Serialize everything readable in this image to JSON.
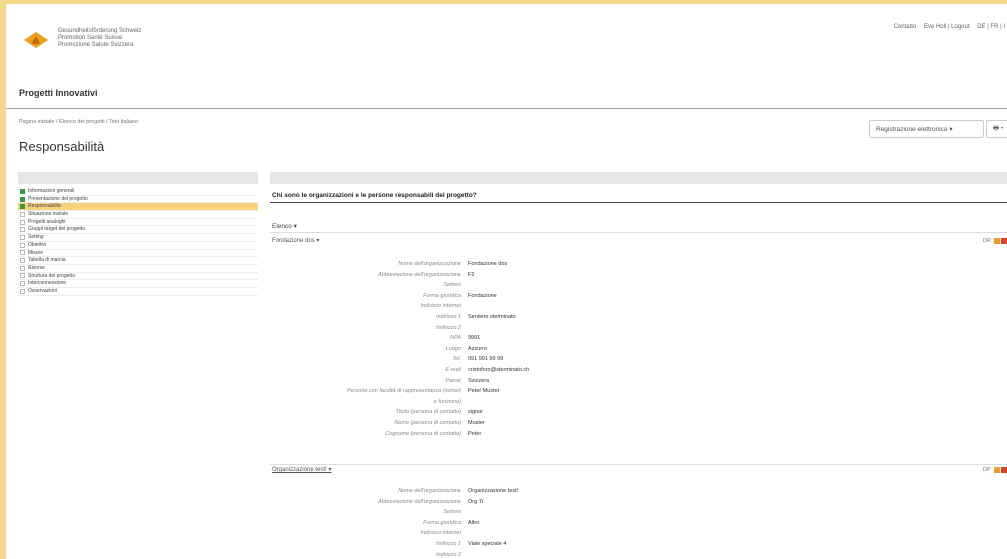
{
  "header": {
    "logo_lines": [
      "Gesundheitsförderung Schweiz",
      "Promotion Santé Suisse",
      "Promozione Salute Svizzera"
    ],
    "links": [
      "Contatto",
      "Eve Holl | Logout",
      "DE | FR | I"
    ]
  },
  "app": {
    "title": "Progetti Innovativi"
  },
  "breadcrumb": "Pagina iniziale / Elenco dei progetti / Test italiano",
  "page_title": "Responsabilità",
  "toolbar": {
    "registration": "Registrazione elettronica ▾",
    "print": "🖶 ▾"
  },
  "sidebar": {
    "items": [
      {
        "label": "Informazioni generali",
        "done": true
      },
      {
        "label": "Presentazione del progetto",
        "done": true
      },
      {
        "label": "Responsabilità",
        "done": true,
        "active": true
      },
      {
        "label": "Situazione iniziale",
        "done": false
      },
      {
        "label": "Progetti analoghi",
        "done": false
      },
      {
        "label": "Gruppi target del progetto",
        "done": false
      },
      {
        "label": "Setting",
        "done": false
      },
      {
        "label": "Obiettivi",
        "done": false
      },
      {
        "label": "Misure",
        "done": false
      },
      {
        "label": "Tabella di marcia",
        "done": false
      },
      {
        "label": "Risorse",
        "done": false
      },
      {
        "label": "Struttura del progetto",
        "done": false
      },
      {
        "label": "Interconnessione",
        "done": false
      },
      {
        "label": "Osservazioni",
        "done": false
      }
    ]
  },
  "main": {
    "question": "Chi sono le organizzazioni e le persone responsabili del progetto?",
    "list_label": "Elenco ▾",
    "orgs": [
      {
        "name": "Fondazione dos ▾",
        "tag": "DR",
        "fields": [
          {
            "label": "Nome dell'organizzazione",
            "value": "Fondazione dos"
          },
          {
            "label": "Abbreviazione dell'organizzazione",
            "value": "F2"
          },
          {
            "label": "Settore",
            "value": ""
          },
          {
            "label": "Forma giuridica",
            "value": "Fondazione"
          },
          {
            "label": "Indirizzo internet",
            "value": ""
          },
          {
            "label": "Indirizzo 1",
            "value": "Sentiero sterminato"
          },
          {
            "label": "Indirizzo 2",
            "value": ""
          },
          {
            "label": "NPA",
            "value": "9991"
          },
          {
            "label": "Luogo",
            "value": "Azzurro"
          },
          {
            "label": "Tel.",
            "value": "091 991 99 99"
          },
          {
            "label": "E-mail",
            "value": "cristoforo@sterminato.ch"
          },
          {
            "label": "Paese",
            "value": "Svizzera"
          },
          {
            "label": "Persone con facoltà di rappresentanza (nome/i",
            "value": "Peter Muster"
          },
          {
            "label": "e funzione)",
            "value": ""
          },
          {
            "label": "Titolo (persona di contatto)",
            "value": "signor"
          },
          {
            "label": "Nome (persona di contatto)",
            "value": "Muster"
          },
          {
            "label": "Cognome (persona di contatto)",
            "value": "Peter"
          }
        ]
      },
      {
        "name": "Organizzazione test! ▾",
        "tag": "DP",
        "fields": [
          {
            "label": "Nome dell'organizzazione",
            "value": "Organizzazione test!"
          },
          {
            "label": "Abbreviazione dell'organizzazione",
            "value": "Org Ti"
          },
          {
            "label": "Settore",
            "value": ""
          },
          {
            "label": "Forma giuridica",
            "value": "Altro"
          },
          {
            "label": "Indirizzo internet",
            "value": ""
          },
          {
            "label": "Indirizzo 1",
            "value": "Viale speciale 4"
          },
          {
            "label": "Indirizzo 2",
            "value": ""
          }
        ]
      }
    ]
  },
  "colors": {
    "active": "#f6d27a",
    "done": "#3a9b3a",
    "edit": "#f29a2a",
    "delete": "#d9412b",
    "background": "#f5d98a"
  }
}
